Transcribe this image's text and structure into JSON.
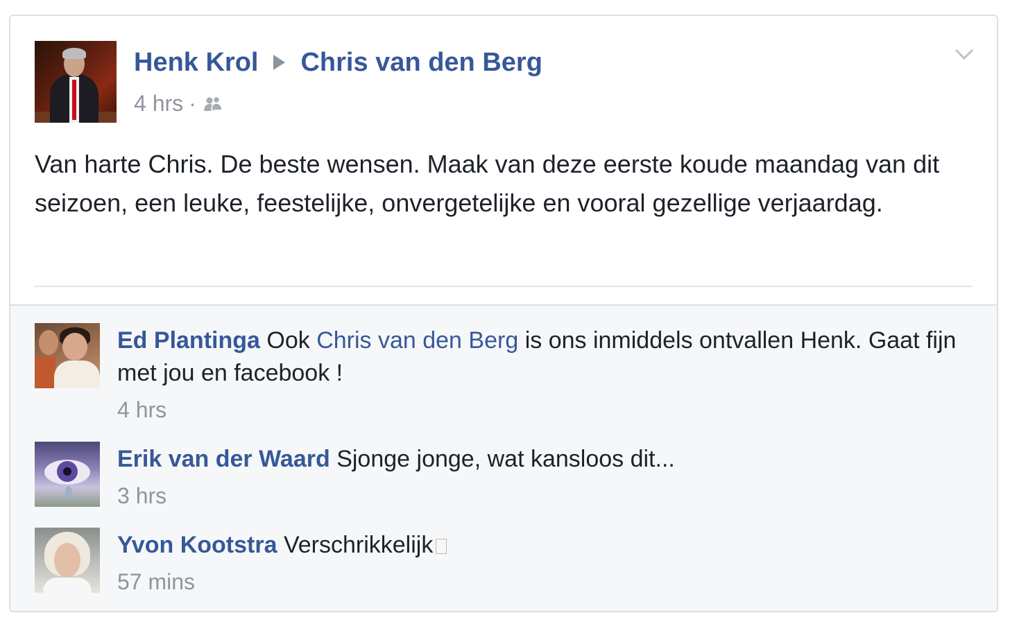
{
  "post": {
    "author": "Henk Krol",
    "target": "Chris van den Berg",
    "time": "4 hrs",
    "separator": "·",
    "audience_icon": "friends-icon",
    "options_icon": "chevron-down-icon",
    "text": "Van harte Chris. De beste wensen. Maak van deze eerste koude maandag van dit seizoen, een leuke, feestelijke, onvergetelijke en vooral gezellige verjaardag."
  },
  "comments": [
    {
      "author": "Ed Plantinga",
      "text_before": "Ook",
      "mention": "Chris van den Berg",
      "text_after": "is ons inmiddels ontvallen Henk. Gaat fijn met jou en facebook !",
      "time": "4 hrs"
    },
    {
      "author": "Erik van der Waard",
      "text": "Sjonge jonge, wat kansloos dit...",
      "time": "3 hrs"
    },
    {
      "author": "Yvon Kootstra",
      "text": "Verschrikkelijk",
      "time": "57 mins"
    }
  ],
  "colors": {
    "link": "#365899",
    "meta": "#90949c",
    "text": "#1d2129",
    "comment_bg": "#f6f7f9",
    "border": "#dddfe2"
  }
}
